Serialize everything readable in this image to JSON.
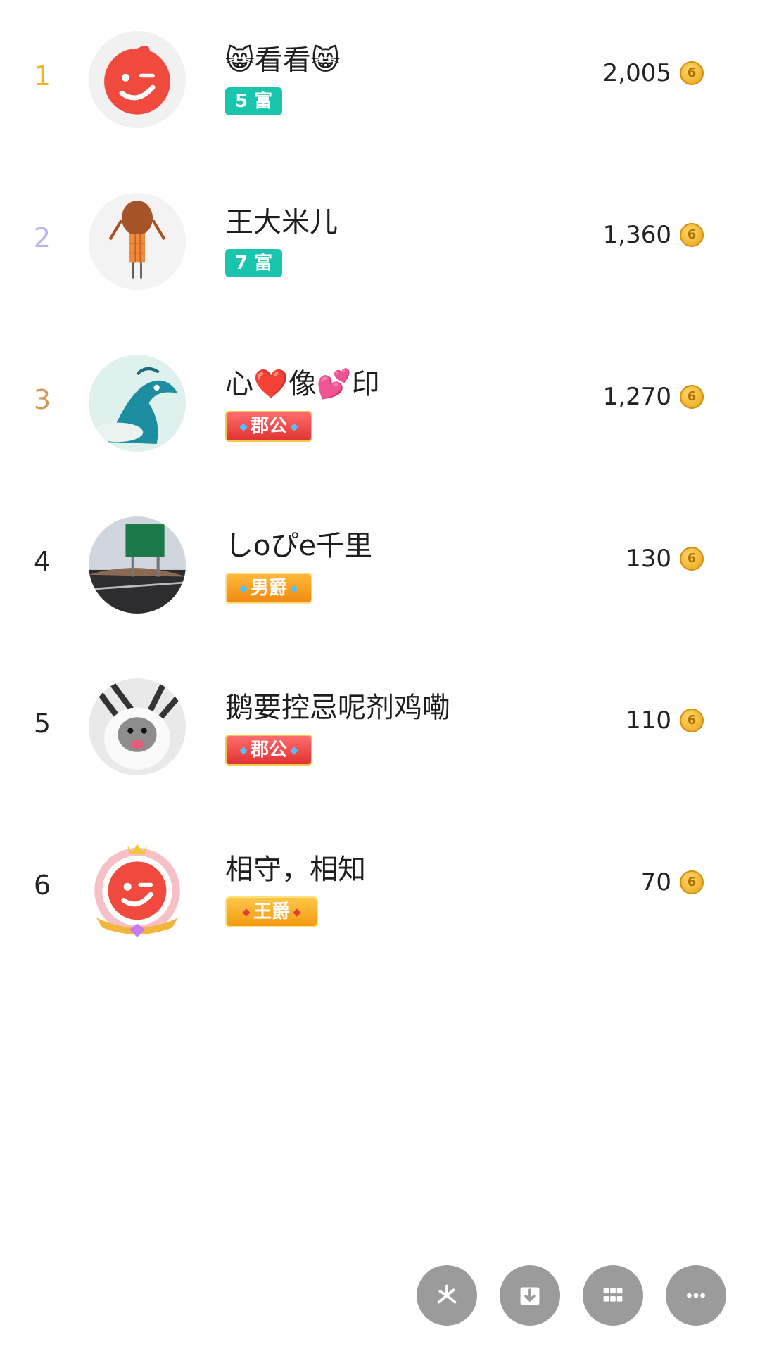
{
  "leaderboard": [
    {
      "rank": "1",
      "rank_color": "#f3b51c",
      "name": "😸看看😸",
      "badge": "5 富",
      "badge_type": "rich",
      "score": "2,005",
      "avatar": "logo-face-avatar"
    },
    {
      "rank": "2",
      "rank_color": "#b7b8e6",
      "name": "王大米儿",
      "badge": "7 富",
      "badge_type": "rich",
      "score": "1,360",
      "avatar": "girl-avatar"
    },
    {
      "rank": "3",
      "rank_color": "#d29a5a",
      "name": "心❤️像💕印",
      "badge": "郡公",
      "badge_type": "duke",
      "score": "1,270",
      "avatar": "dragon-avatar"
    },
    {
      "rank": "4",
      "rank_color": "#222222",
      "name": "しoぴe千里",
      "badge": "男爵",
      "badge_type": "baron",
      "score": "130",
      "avatar": "road-sign-avatar"
    },
    {
      "rank": "5",
      "rank_color": "#222222",
      "name": "鹅要控忌呢剂鸡嘞",
      "badge": "郡公",
      "badge_type": "duke",
      "score": "110",
      "avatar": "cat-avatar"
    },
    {
      "rank": "6",
      "rank_color": "#222222",
      "name": "相守，相知",
      "badge": "王爵",
      "badge_type": "king",
      "score": "70",
      "avatar": "crowned-logo-avatar"
    }
  ],
  "coin_symbol": "6",
  "toolbar": {
    "buttons": [
      "share-icon",
      "download-icon",
      "grid-icon",
      "more-icon"
    ]
  },
  "colors": {
    "rich_badge": "#19c6ad",
    "logo_red": "#f04a3e",
    "toolbar_button": "#9b9b9b"
  }
}
